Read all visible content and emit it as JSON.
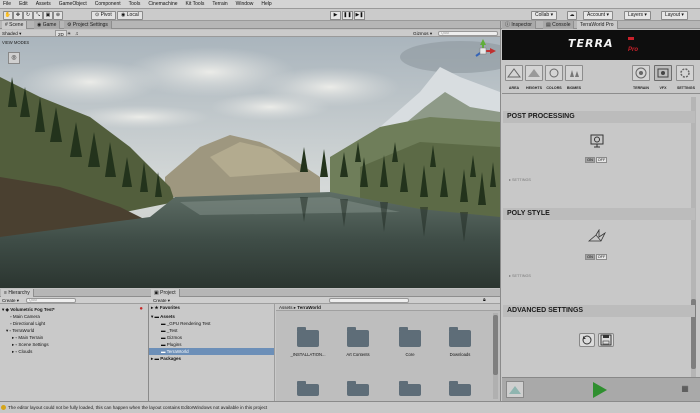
{
  "menu": [
    "File",
    "Edit",
    "Assets",
    "GameObject",
    "Component",
    "Tools",
    "Cinemachine",
    "Kit Tools",
    "Terrain",
    "Window",
    "Help"
  ],
  "toolbar": {
    "pivot_label": "Pivot",
    "space_label": "Local",
    "collab_label": "Collab ▾",
    "account_label": "Account ▾",
    "layers_label": "Layers ▾",
    "layout_label": "Layout ▾",
    "play_icon": "▶",
    "pause_icon": "❚❚",
    "step_icon": "▶❚"
  },
  "scene_tabs": [
    "Scene",
    "Game",
    "Project Settings"
  ],
  "scene_toolbar": {
    "shading": "Shaded",
    "mode_2d": "2D",
    "gizmos": "Gizmos ▾",
    "search_placeholder": "Q•All"
  },
  "scene_overlay": {
    "view_modes": "VIEW MODES"
  },
  "inspector": {
    "tabs": [
      "Inspector",
      "Console",
      "TerraWorld Pro"
    ],
    "logo": {
      "main": "TERRA",
      "sub": "Pro"
    },
    "left_icon_labels": [
      "AREA",
      "HEIGHTS",
      "COLORS",
      "BIOMES"
    ],
    "right_icon_labels": [
      "TERRAIN",
      "VFX",
      "SETTINGS"
    ],
    "sections": [
      {
        "title": "POST PROCESSING",
        "on": "ON",
        "off": "OFF",
        "settings": "SETTINGS"
      },
      {
        "title": "POLY STYLE",
        "on": "ON",
        "off": "OFF",
        "settings": "SETTINGS"
      },
      {
        "title": "ADVANCED SETTINGS"
      }
    ]
  },
  "hierarchy": {
    "tab": "Hierarchy",
    "create": "Create ▾",
    "search_placeholder": "Q•All",
    "items": [
      {
        "label": "Volumetric Fog Test*",
        "depth": 0
      },
      {
        "label": "Main Camera",
        "depth": 1
      },
      {
        "label": "Directional Light",
        "depth": 1
      },
      {
        "label": "TerraWorld",
        "depth": 1
      },
      {
        "label": "Main Terrain",
        "depth": 2
      },
      {
        "label": "Scene Settings",
        "depth": 2
      },
      {
        "label": "Clouds",
        "depth": 2
      }
    ]
  },
  "project": {
    "tab": "Project",
    "create": "Create ▾",
    "tree": [
      {
        "label": "Favorites",
        "depth": 0,
        "bold": true
      },
      {
        "label": "Assets",
        "depth": 0,
        "bold": true
      },
      {
        "label": "_GPU Rendering Test",
        "depth": 1
      },
      {
        "label": "_Test",
        "depth": 1
      },
      {
        "label": "Gizmos",
        "depth": 1
      },
      {
        "label": "Plugins",
        "depth": 1
      },
      {
        "label": "TerraWorld",
        "depth": 1,
        "selected": true
      },
      {
        "label": "Packages",
        "depth": 0,
        "bold": true
      }
    ],
    "breadcrumb": [
      "Assets",
      "TerraWorld"
    ],
    "folders": [
      "_INSTALLATION...",
      "Art Contents",
      "Core",
      "Downloads"
    ]
  },
  "status": "The editor layout could not be fully loaded, this can happen when the layout contains EditorWindows not available in this project",
  "colors": {
    "accent_green": "#2f8f2f",
    "selection": "#6c8fb8",
    "terra_logo_bg": "#0e0e0e",
    "terra_red": "#c8202a"
  }
}
